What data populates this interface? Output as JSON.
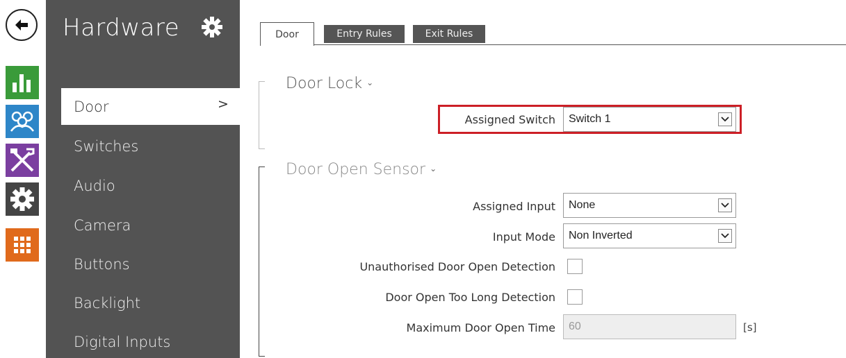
{
  "rail": {
    "icons": [
      "back-arrow-icon",
      "chart-icon",
      "users-icon",
      "tools-icon",
      "gear-icon",
      "grid-icon"
    ],
    "colors": {
      "chart": "#3a9b3a",
      "users": "#2e86c8",
      "tools": "#7b3fa0",
      "gear": "#444444",
      "grid": "#e06a1c"
    }
  },
  "sidebar": {
    "title": "Hardware",
    "items": [
      {
        "label": "Door",
        "active": true
      },
      {
        "label": "Switches"
      },
      {
        "label": "Audio"
      },
      {
        "label": "Camera"
      },
      {
        "label": "Buttons"
      },
      {
        "label": "Backlight"
      },
      {
        "label": "Digital Inputs"
      }
    ],
    "active_chevron": ">"
  },
  "tabs": [
    {
      "label": "Door",
      "active": true
    },
    {
      "label": "Entry Rules"
    },
    {
      "label": "Exit Rules"
    }
  ],
  "door_lock": {
    "title": "Door Lock",
    "assigned_switch_label": "Assigned Switch",
    "assigned_switch_value": "Switch 1"
  },
  "door_open_sensor": {
    "title": "Door Open Sensor",
    "assigned_input_label": "Assigned Input",
    "assigned_input_value": "None",
    "input_mode_label": "Input Mode",
    "input_mode_value": "Non Inverted",
    "unauthorised_label": "Unauthorised Door Open Detection",
    "unauthorised_checked": false,
    "too_long_label": "Door Open Too Long Detection",
    "too_long_checked": false,
    "max_time_label": "Maximum Door Open Time",
    "max_time_value": "60",
    "max_time_unit": "[s]"
  },
  "colors": {
    "highlight": "#cc1f26",
    "sidebar_bg": "#535353"
  }
}
